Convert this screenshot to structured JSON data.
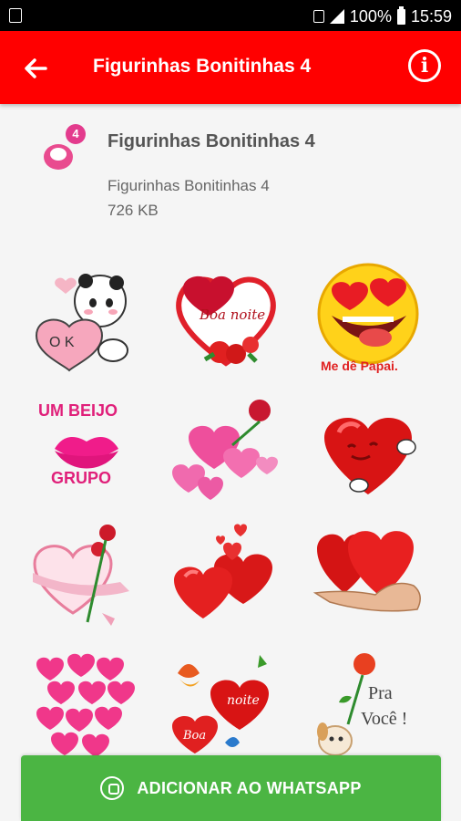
{
  "status_bar": {
    "battery": "100%",
    "time": "15:59",
    "icons": [
      "notification-icon",
      "lock-icon",
      "signal-icon",
      "battery-icon"
    ]
  },
  "app_bar": {
    "title": "Figurinhas Bonitinhas 4",
    "back_icon": "arrow-left-icon",
    "info_icon": "info-icon",
    "info_glyph": "i",
    "color": "#ff0000"
  },
  "pack": {
    "title": "Figurinhas Bonitinhas 4",
    "badge": "4",
    "publisher": "Figurinhas Bonitinhas 4",
    "size": "726 KB"
  },
  "stickers": [
    {
      "name": "panda-ok-heart",
      "text": "O K"
    },
    {
      "name": "boa-noite-heart-frame",
      "text": "Boa noite"
    },
    {
      "name": "heart-eyes-emoji",
      "text": "Me dê Papai."
    },
    {
      "name": "um-beijo-grupo",
      "text_top": "UM BEIJO",
      "text_bottom": "GRUPO"
    },
    {
      "name": "pink-hearts-rose"
    },
    {
      "name": "red-heart-character"
    },
    {
      "name": "heart-with-rose-ribbon"
    },
    {
      "name": "two-red-hearts"
    },
    {
      "name": "hand-holding-hearts"
    },
    {
      "name": "pink-hearts-cluster"
    },
    {
      "name": "boa-noite-hearts-butterfly",
      "text_a": "noite",
      "text_b": "Boa"
    },
    {
      "name": "pra-voce-rose-dog",
      "text_a": "Pra",
      "text_b": "Você !"
    }
  ],
  "add_button": {
    "label": "ADICIONAR AO WHATSAPP",
    "icon": "whatsapp-icon",
    "color": "#4bb543"
  }
}
